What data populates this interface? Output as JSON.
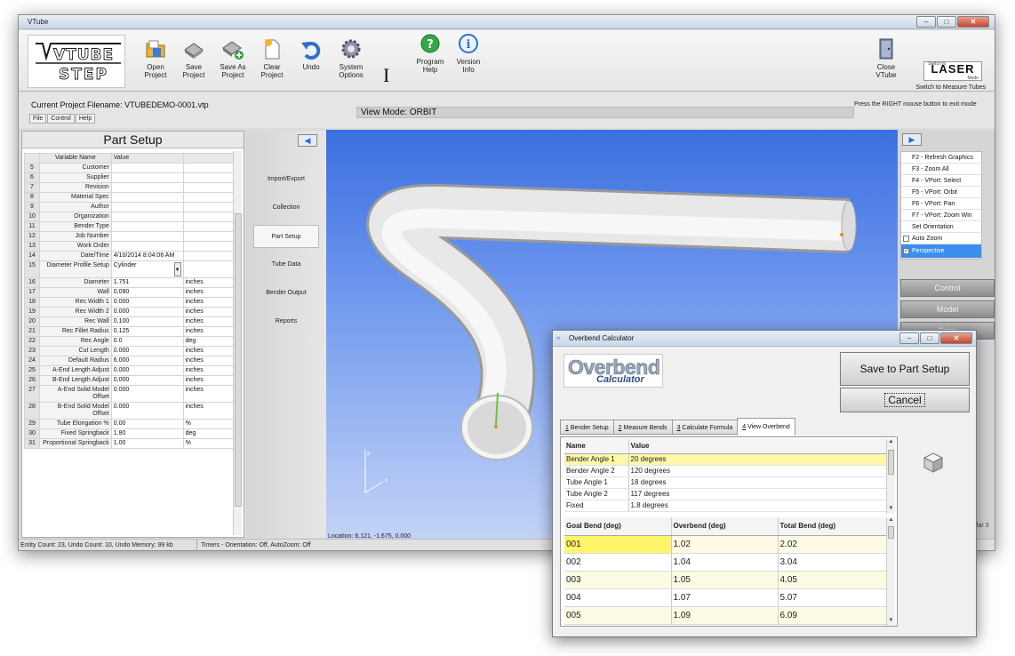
{
  "window": {
    "title": "VTube"
  },
  "ribbon": {
    "logo_line1": "VTUBE",
    "logo_line2": "STEP",
    "tools": [
      {
        "line1": "Open",
        "line2": "Project",
        "icon": "open-folder-icon"
      },
      {
        "line1": "Save",
        "line2": "Project",
        "icon": "save-disk-icon"
      },
      {
        "line1": "Save As",
        "line2": "Project",
        "icon": "save-as-icon"
      },
      {
        "line1": "Clear",
        "line2": "Project",
        "icon": "new-document-icon"
      },
      {
        "line1": "Undo",
        "line2": "",
        "icon": "undo-arrow-icon"
      },
      {
        "line1": "System",
        "line2": "Options",
        "icon": "gear-icon"
      },
      {
        "line1": "Program",
        "line2": "Help",
        "icon": "help-icon"
      },
      {
        "line1": "Version",
        "line2": "Info",
        "icon": "info-icon"
      }
    ],
    "close": {
      "line1": "Close",
      "line2": "VTube"
    },
    "laser": {
      "top": "Switch to",
      "main": "LASER",
      "bottom": "Mode",
      "caption": "Switch to Measure Tubes"
    }
  },
  "infobar": {
    "project_label": "Current Project Filename:",
    "project_file": "VTUBEDEMO-0001.vtp",
    "menu": [
      "File",
      "Control",
      "Help"
    ],
    "view_mode": "View Mode: ORBIT",
    "hint": "Press the RIGHT mouse button to exit mode"
  },
  "part_setup": {
    "title": "Part Setup",
    "col_name": "Variable Name",
    "col_value": "Value",
    "rows": [
      {
        "n": "5",
        "name": "Customer",
        "value": "",
        "unit": ""
      },
      {
        "n": "6",
        "name": "Supplier",
        "value": "",
        "unit": ""
      },
      {
        "n": "7",
        "name": "Revision",
        "value": "",
        "unit": ""
      },
      {
        "n": "8",
        "name": "Material Spec",
        "value": "",
        "unit": ""
      },
      {
        "n": "9",
        "name": "Author",
        "value": "",
        "unit": ""
      },
      {
        "n": "10",
        "name": "Organization",
        "value": "",
        "unit": ""
      },
      {
        "n": "11",
        "name": "Bender Type",
        "value": "",
        "unit": ""
      },
      {
        "n": "12",
        "name": "Job Number",
        "value": "",
        "unit": ""
      },
      {
        "n": "13",
        "name": "Work Order",
        "value": "",
        "unit": ""
      },
      {
        "n": "14",
        "name": "Date/Time",
        "value": "4/10/2014 8:04:06 AM",
        "unit": ""
      },
      {
        "n": "15",
        "name": "Diameter Profile Setup",
        "value": "Cylinder",
        "unit": ""
      },
      {
        "n": "16",
        "name": "Diameter",
        "value": "1.751",
        "unit": "inches"
      },
      {
        "n": "17",
        "name": "Wall",
        "value": "0.090",
        "unit": "inches"
      },
      {
        "n": "18",
        "name": "Rec Width 1",
        "value": "0.000",
        "unit": "inches"
      },
      {
        "n": "19",
        "name": "Rec Width 2",
        "value": "0.000",
        "unit": "inches"
      },
      {
        "n": "20",
        "name": "Rec Wall",
        "value": "0.100",
        "unit": "inches"
      },
      {
        "n": "21",
        "name": "Rec Fillet Radius",
        "value": "0.125",
        "unit": "inches"
      },
      {
        "n": "22",
        "name": "Rec Angle",
        "value": "0.0",
        "unit": "deg"
      },
      {
        "n": "23",
        "name": "Cut Length",
        "value": "0.000",
        "unit": "inches"
      },
      {
        "n": "24",
        "name": "Default Radius",
        "value": "6.000",
        "unit": "inches"
      },
      {
        "n": "25",
        "name": "A-End Length Adjust",
        "value": "0.000",
        "unit": "inches"
      },
      {
        "n": "26",
        "name": "B-End Length Adjust",
        "value": "0.000",
        "unit": "inches"
      },
      {
        "n": "27",
        "name": "A-End Solid Model Offset",
        "value": "0.000",
        "unit": "inches"
      },
      {
        "n": "28",
        "name": "B-End Solid Model Offset",
        "value": "0.000",
        "unit": "inches"
      },
      {
        "n": "29",
        "name": "Tube Elongation %",
        "value": "0.00",
        "unit": "%"
      },
      {
        "n": "30",
        "name": "Fixed Springback",
        "value": "1.80",
        "unit": "deg"
      },
      {
        "n": "31",
        "name": "Proportional Springback",
        "value": "1.00",
        "unit": "%"
      }
    ]
  },
  "nav": {
    "items": [
      "Import/Export",
      "Collection",
      "Part Setup",
      "Tube Data",
      "Bender Output",
      "Reports"
    ],
    "active": "Part Setup"
  },
  "viewport": {
    "location": "Location: 6.121, -1.675, 0.000"
  },
  "right_panel": {
    "items": [
      "F2 - Refresh Graphics",
      "F3 - Zoom All",
      "F4 - VPort: Select",
      "F5 - VPort: Orbit",
      "F6 - VPort: Pan",
      "F7 - VPort: Zoom Win",
      "Set Orientation"
    ],
    "auto_zoom": "Auto Zoom",
    "perspective": "Perspective",
    "buttons": [
      "Control",
      "Model",
      "Color"
    ],
    "partial_text": "ular 3"
  },
  "status": {
    "left": "Entity Count: 23, Undo Count: 10, Undo Memory: 99 kb",
    "right": "Timers - Orientation: Off, AutoZoom: Off"
  },
  "dialog": {
    "title": "Overbend Calculator",
    "logo_big": "Overbend",
    "logo_small": "Calculator",
    "save_button": "Save to Part Setup",
    "cancel_button": "Cancel",
    "tabs": [
      {
        "key": "1",
        "label": " Bender Setup"
      },
      {
        "key": "2",
        "label": " Measure Bends"
      },
      {
        "key": "3",
        "label": " Calculate Formula"
      },
      {
        "key": "4",
        "label": " View Overbend"
      }
    ],
    "active_tab": "4",
    "summary_headers": [
      "Name",
      "Value"
    ],
    "summary": [
      {
        "name": "Bender Angle 1",
        "value": "20 degrees"
      },
      {
        "name": "Bender Angle 2",
        "value": "120 degrees"
      },
      {
        "name": "Tube Angle 1",
        "value": "18 degrees"
      },
      {
        "name": "Tube Angle 2",
        "value": "117 degrees"
      },
      {
        "name": "Fixed",
        "value": "1.8 degrees"
      }
    ],
    "table_headers": [
      "Goal Bend (deg)",
      "Overbend (deg)",
      "Total Bend (deg)"
    ],
    "table": [
      [
        "001",
        "1.02",
        "2.02"
      ],
      [
        "002",
        "1.04",
        "3.04"
      ],
      [
        "003",
        "1.05",
        "4.05"
      ],
      [
        "004",
        "1.07",
        "5.07"
      ],
      [
        "005",
        "1.09",
        "6.09"
      ]
    ]
  }
}
